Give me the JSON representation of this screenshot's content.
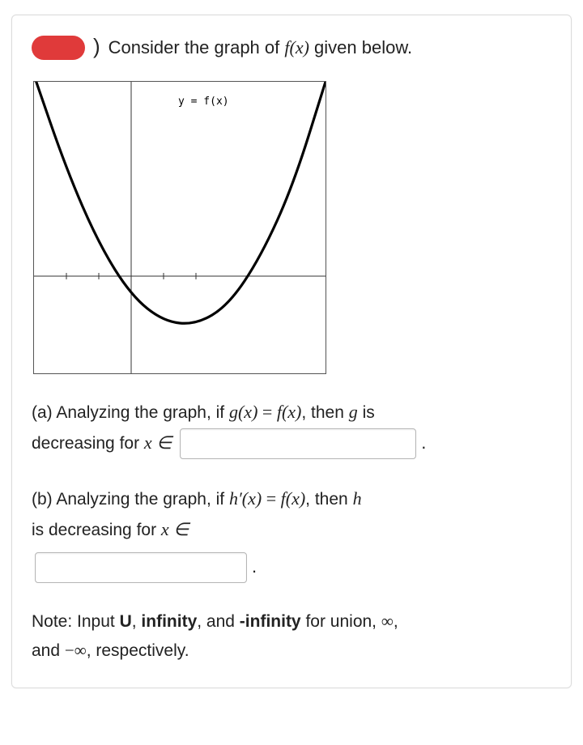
{
  "prompt": {
    "paren_close": ")",
    "pre": "Consider the graph of ",
    "fx": "f(x)",
    "post": " given below."
  },
  "graph": {
    "label": "y = f(x)"
  },
  "part_a": {
    "label": "(a) Analyzing the graph, if ",
    "gx": "g(x)",
    "eq": " = ",
    "fx": "f(x)",
    "then": ", then ",
    "g_italic": "g",
    "is": " is",
    "decreasing": "decreasing for ",
    "x_in": "x ∈",
    "period": "."
  },
  "part_b": {
    "label": "(b) Analyzing the graph, if ",
    "hprime": "h′(x)",
    "eq": " = ",
    "fx": "f(x)",
    "then": ", then ",
    "h_italic": "h",
    "is_dec": "is decreasing for ",
    "x_in": "x ∈",
    "period": "."
  },
  "note": {
    "pre": "Note: Input ",
    "u": "U",
    "comma1": ", ",
    "inf": "infinity",
    "and1": ", and ",
    "ninf": "-infinity",
    "for": " for union, ",
    "sym_inf": "∞",
    "comma2": ",",
    "and2": "and ",
    "sym_ninf": "−∞",
    "resp": ", respectively."
  },
  "chart_data": {
    "type": "line",
    "title": "y = f(x)",
    "xlabel": "",
    "ylabel": "",
    "xlim": [
      -3,
      6
    ],
    "ylim": [
      -3,
      6
    ],
    "x": [
      -3,
      -2,
      -1,
      0,
      1,
      2,
      3,
      4,
      5,
      6
    ],
    "values": [
      6.2,
      3.3,
      1.0,
      -0.6,
      -1.4,
      -1.5,
      -0.9,
      0.6,
      2.8,
      6.0
    ],
    "note": "Axes intersect near (0,0); curve is U-shaped with minimum near x≈2, y≈-1.5; crosses x-axis near x≈-0.5 and x≈3.7."
  }
}
